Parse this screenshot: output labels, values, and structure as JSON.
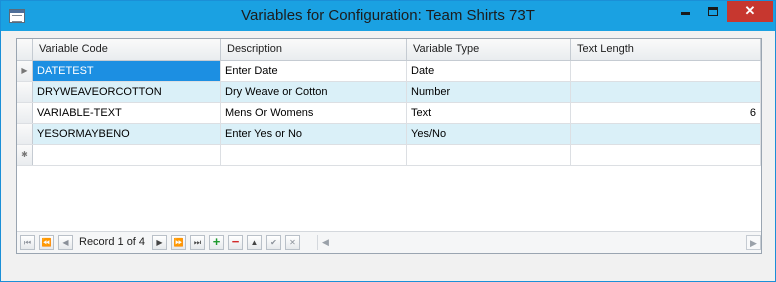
{
  "window": {
    "title": "Variables for Configuration: Team Shirts 73T",
    "minimize_icon": "minimize-icon",
    "maximize_icon": "maximize-icon",
    "close_glyph": "✕"
  },
  "grid": {
    "columns": [
      "Variable Code",
      "Description",
      "Variable Type",
      "Text Length"
    ],
    "rows": [
      {
        "code": "DATETEST",
        "description": "Enter Date",
        "type": "Date",
        "length": ""
      },
      {
        "code": "DRYWEAVEORCOTTON",
        "description": "Dry Weave or Cotton",
        "type": "Number",
        "length": ""
      },
      {
        "code": "VARIABLE-TEXT",
        "description": "Mens Or Womens",
        "type": "Text",
        "length": "6"
      },
      {
        "code": "YESORMAYBENO",
        "description": "Enter Yes or No",
        "type": "Yes/No",
        "length": ""
      }
    ],
    "current_row_glyph": "▶",
    "new_row_glyph": "✱",
    "selection_color": "#1c8fe2",
    "alt_row_color": "#daf0f8"
  },
  "navigator": {
    "record_text": "Record 1 of 4",
    "first_glyph": "⏮",
    "prev_page_glyph": "⏪",
    "prev_glyph": "◀",
    "next_glyph": "▶",
    "next_page_glyph": "⏩",
    "last_glyph": "⏭",
    "add_glyph": "+",
    "delete_glyph": "−",
    "up_glyph": "▲",
    "check_glyph": "✔",
    "cancel_glyph": "✕",
    "scroll_left_glyph": "◀",
    "scroll_right_glyph": "▶"
  }
}
